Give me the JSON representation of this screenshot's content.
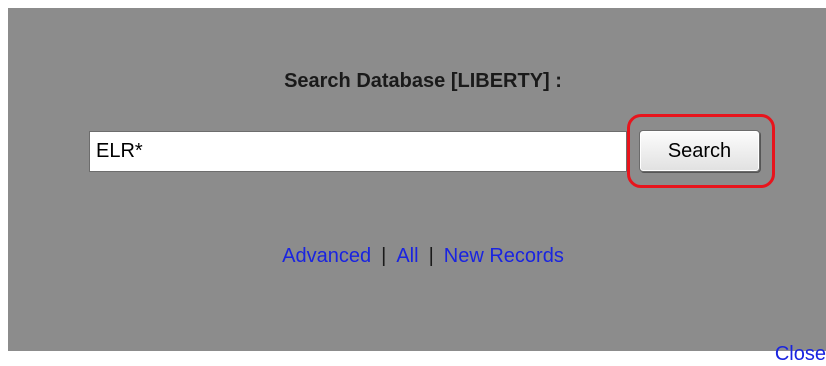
{
  "dialog": {
    "title": "Search Database [LIBERTY] :"
  },
  "search": {
    "value": "ELR*",
    "placeholder": "",
    "button_label": "Search"
  },
  "links": {
    "advanced": "Advanced",
    "all": "All",
    "new_records": "New Records",
    "separator": "|"
  },
  "footer": {
    "close": "Close"
  },
  "colors": {
    "panel_background": "#8c8c8c",
    "link": "#1a24e0",
    "highlight": "#e8141c"
  }
}
